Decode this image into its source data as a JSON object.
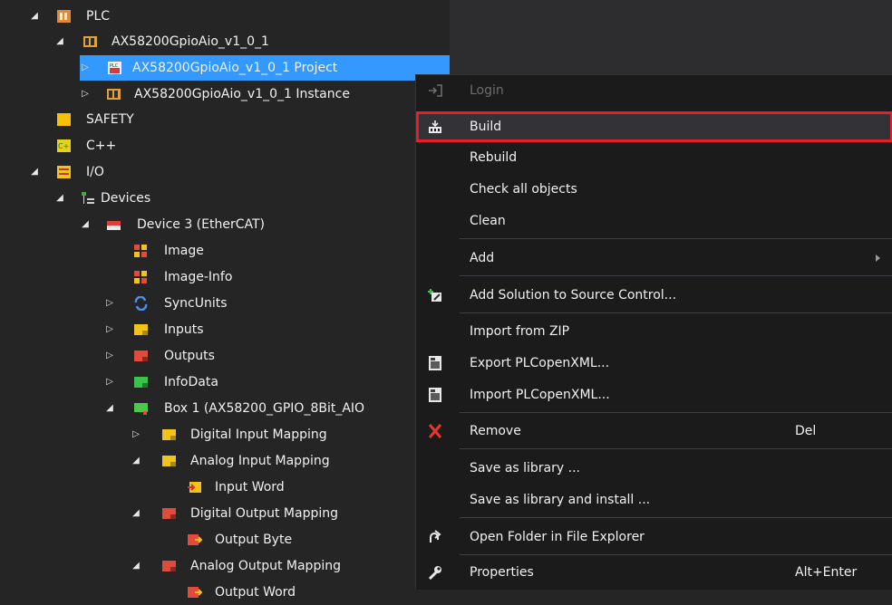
{
  "tree": {
    "rows": [
      {
        "label": "PLC"
      },
      {
        "label": "AX58200GpioAio_v1_0_1"
      },
      {
        "label": "AX58200GpioAio_v1_0_1 Project"
      },
      {
        "label": "AX58200GpioAio_v1_0_1 Instance"
      },
      {
        "label": "SAFETY"
      },
      {
        "label": "C++"
      },
      {
        "label": "I/O"
      },
      {
        "label": "Devices"
      },
      {
        "label": "Device 3 (EtherCAT)"
      },
      {
        "label": "Image"
      },
      {
        "label": "Image-Info"
      },
      {
        "label": "SyncUnits"
      },
      {
        "label": "Inputs"
      },
      {
        "label": "Outputs"
      },
      {
        "label": "InfoData"
      },
      {
        "label": "Box 1 (AX58200_GPIO_8Bit_AIO"
      },
      {
        "label": "Digital Input Mapping"
      },
      {
        "label": "Analog Input Mapping"
      },
      {
        "label": "Input Word"
      },
      {
        "label": "Digital Output Mapping"
      },
      {
        "label": "Output Byte"
      },
      {
        "label": "Analog Output Mapping"
      },
      {
        "label": "Output Word"
      }
    ],
    "colors": {
      "selection": "#3399ff",
      "background": "#252526"
    }
  },
  "menu": {
    "items": [
      {
        "label": "Login",
        "shortcut": "",
        "icon": "login-icon",
        "disabled": true
      },
      {
        "label": "Build",
        "shortcut": "",
        "icon": "build-icon",
        "highlighted": true
      },
      {
        "label": "Rebuild",
        "shortcut": ""
      },
      {
        "label": "Check all objects",
        "shortcut": ""
      },
      {
        "label": "Clean",
        "shortcut": ""
      },
      {
        "label": "Add",
        "shortcut": "",
        "submenu": true
      },
      {
        "label": "Add Solution to Source Control...",
        "shortcut": "",
        "icon": "source-control-icon"
      },
      {
        "label": "Import from ZIP",
        "shortcut": ""
      },
      {
        "label": "Export PLCopenXML...",
        "shortcut": "",
        "icon": "export-xml-icon"
      },
      {
        "label": "Import PLCopenXML...",
        "shortcut": "",
        "icon": "import-xml-icon"
      },
      {
        "label": "Remove",
        "shortcut": "Del",
        "icon": "remove-icon"
      },
      {
        "label": "Save as library ...",
        "shortcut": ""
      },
      {
        "label": "Save as library and install ...",
        "shortcut": ""
      },
      {
        "label": "Open Folder in File Explorer",
        "shortcut": "",
        "icon": "open-folder-icon"
      },
      {
        "label": "Properties",
        "shortcut": "Alt+Enter",
        "icon": "properties-icon"
      }
    ],
    "colors": {
      "background": "#1b1b1c",
      "highlight_border": "#e51e2a",
      "disabled_text": "#6d6d6d"
    }
  }
}
